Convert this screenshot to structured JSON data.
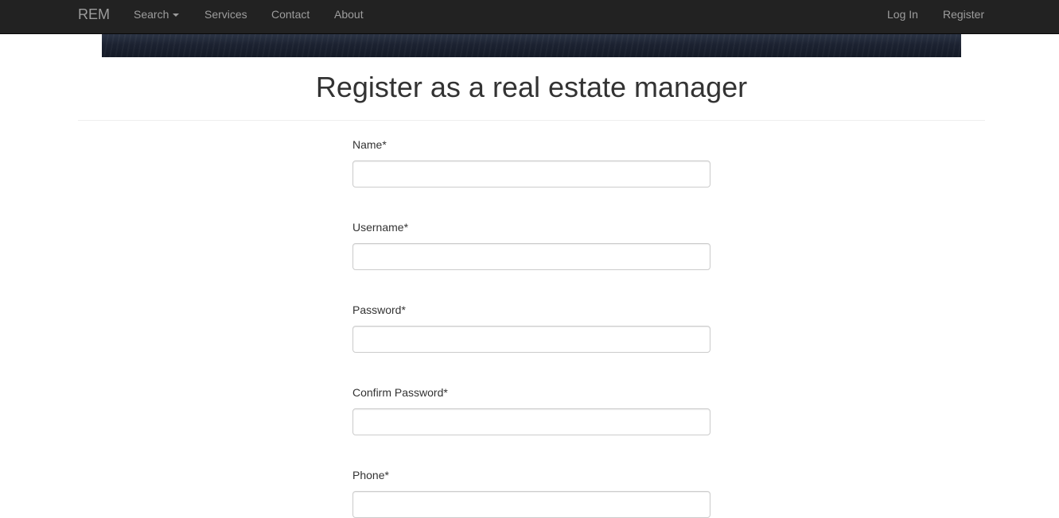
{
  "navbar": {
    "brand": "REM",
    "left_items": [
      {
        "label": "Search",
        "has_caret": true
      },
      {
        "label": "Services"
      },
      {
        "label": "Contact"
      },
      {
        "label": "About"
      }
    ],
    "right_items": [
      {
        "label": "Log In"
      },
      {
        "label": "Register"
      }
    ]
  },
  "page": {
    "title": "Register as a real estate manager"
  },
  "form": {
    "fields": [
      {
        "label": "Name*",
        "value": "",
        "placeholder": ""
      },
      {
        "label": "Username*",
        "value": "",
        "placeholder": ""
      },
      {
        "label": "Password*",
        "value": "",
        "placeholder": ""
      },
      {
        "label": "Confirm Password*",
        "value": "",
        "placeholder": ""
      },
      {
        "label": "Phone*",
        "value": "",
        "placeholder": ""
      }
    ]
  },
  "colors": {
    "navbar_bg": "#222222",
    "nav_text": "#9d9d9d",
    "text": "#333333",
    "input_border": "#cccccc"
  }
}
